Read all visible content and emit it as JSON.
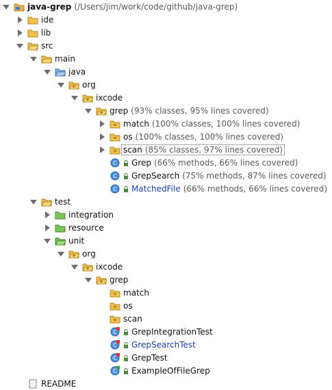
{
  "root": {
    "label": "java-grep",
    "path": "(/Users/jim/work/code/github/java-grep)"
  },
  "rows": [
    {
      "name": "ide",
      "coverage": ""
    },
    {
      "name": "lib",
      "coverage": ""
    },
    {
      "name": "src",
      "coverage": ""
    },
    {
      "name": "main",
      "coverage": ""
    },
    {
      "name": "java",
      "coverage": ""
    },
    {
      "name": "org",
      "coverage": ""
    },
    {
      "name": "ixcode",
      "coverage": ""
    },
    {
      "name": "grep",
      "coverage": "(93% classes, 95% lines covered)"
    },
    {
      "name": "match",
      "coverage": "(100% classes, 100% lines covered)"
    },
    {
      "name": "os",
      "coverage": "(100% classes, 100% lines covered)"
    },
    {
      "name": "scan",
      "coverage": "(85% classes, 97% lines covered)"
    },
    {
      "name": "Grep",
      "coverage": "(66% methods, 66% lines covered)"
    },
    {
      "name": "GrepSearch",
      "coverage": "(75% methods, 87% lines covered)"
    },
    {
      "name": "MatchedFile",
      "coverage": "(66% methods, 66% lines covered)"
    },
    {
      "name": "test",
      "coverage": ""
    },
    {
      "name": "integration",
      "coverage": ""
    },
    {
      "name": "resource",
      "coverage": ""
    },
    {
      "name": "unit",
      "coverage": ""
    },
    {
      "name": "org",
      "coverage": ""
    },
    {
      "name": "ixcode",
      "coverage": ""
    },
    {
      "name": "grep",
      "coverage": ""
    },
    {
      "name": "match",
      "coverage": ""
    },
    {
      "name": "os",
      "coverage": ""
    },
    {
      "name": "scan",
      "coverage": ""
    },
    {
      "name": "GrepIntegrationTest",
      "coverage": ""
    },
    {
      "name": "GrepSearchTest",
      "coverage": ""
    },
    {
      "name": "GrepTest",
      "coverage": ""
    },
    {
      "name": "ExampleOfFileGrep",
      "coverage": ""
    },
    {
      "name": "README",
      "coverage": ""
    }
  ],
  "colors": {
    "text": "#111111",
    "coverage": "#5a5a5a",
    "link_blue": "#1b3fa6",
    "folder": "#e3b24c",
    "folder_green": "#7cc45a",
    "folder_blue": "#7fb0e6",
    "class_icon": "#4d8fe0"
  }
}
